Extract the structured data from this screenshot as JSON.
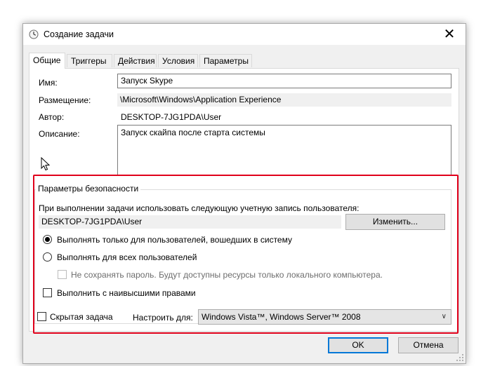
{
  "window": {
    "title": "Создание задачи",
    "close_glyph": "✕"
  },
  "tabs": [
    {
      "label": "Общие"
    },
    {
      "label": "Триггеры"
    },
    {
      "label": "Действия"
    },
    {
      "label": "Условия"
    },
    {
      "label": "Параметры"
    }
  ],
  "general": {
    "name_label": "Имя:",
    "name_value": "Запуск Skype",
    "location_label": "Размещение:",
    "location_value": "\\Microsoft\\Windows\\Application Experience",
    "author_label": "Автор:",
    "author_value": "DESKTOP-7JG1PDA\\User",
    "description_label": "Описание:",
    "description_value": "Запуск скайпа после старта системы"
  },
  "security": {
    "group_title": "Параметры безопасности",
    "account_prompt": "При выполнении задачи использовать следующую учетную запись пользователя:",
    "account_value": "DESKTOP-7JG1PDA\\User",
    "change_button": "Изменить...",
    "radio_logged_on": "Выполнять только для пользователей, вошедших в систему",
    "radio_all_users": "Выполнять для всех пользователей",
    "no_store_password": "Не сохранять пароль. Будут доступны ресурсы только локального компьютера.",
    "highest_privileges": "Выполнить с наивысшими правами"
  },
  "bottom": {
    "hidden_label": "Скрытая задача",
    "configure_label": "Настроить для:",
    "configure_value": "Windows Vista™, Windows Server™ 2008"
  },
  "buttons": {
    "ok": "OK",
    "cancel": "Отмена"
  },
  "colors": {
    "highlight": "#e0001b",
    "accent": "#0078d7"
  },
  "icons": {
    "title": "clock-icon",
    "close": "close-icon",
    "dropdown": "chevron-down-icon",
    "cursor": "mouse-pointer-icon"
  }
}
